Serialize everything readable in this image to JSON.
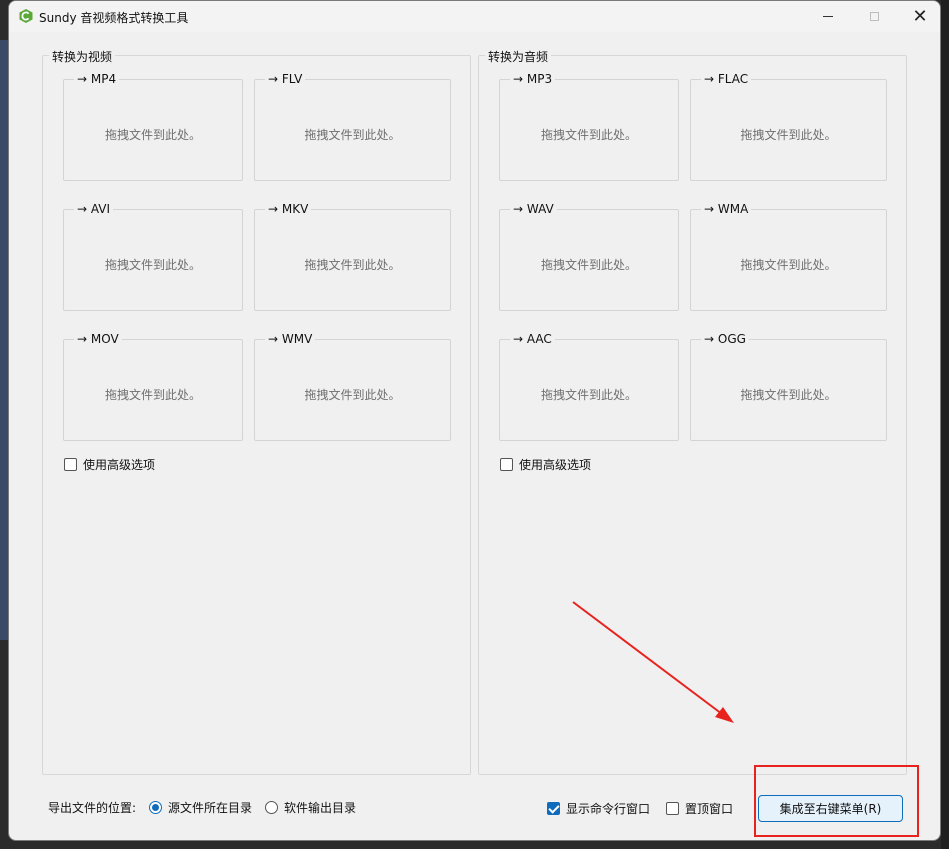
{
  "window": {
    "title": "Sundy 音视频格式转换工具",
    "close_glyph": "✕"
  },
  "video_group": {
    "title": "转换为视频",
    "targets": [
      {
        "label": "→ MP4",
        "hint": "拖拽文件到此处。"
      },
      {
        "label": "→ FLV",
        "hint": "拖拽文件到此处。"
      },
      {
        "label": "→ AVI",
        "hint": "拖拽文件到此处。"
      },
      {
        "label": "→ MKV",
        "hint": "拖拽文件到此处。"
      },
      {
        "label": "→ MOV",
        "hint": "拖拽文件到此处。"
      },
      {
        "label": "→ WMV",
        "hint": "拖拽文件到此处。"
      }
    ],
    "advanced_label": "使用高级选项",
    "advanced_checked": false
  },
  "audio_group": {
    "title": "转换为音频",
    "targets": [
      {
        "label": "→ MP3",
        "hint": "拖拽文件到此处。"
      },
      {
        "label": "→ FLAC",
        "hint": "拖拽文件到此处。"
      },
      {
        "label": "→ WAV",
        "hint": "拖拽文件到此处。"
      },
      {
        "label": "→ WMA",
        "hint": "拖拽文件到此处。"
      },
      {
        "label": "→ AAC",
        "hint": "拖拽文件到此处。"
      },
      {
        "label": "→ OGG",
        "hint": "拖拽文件到此处。"
      }
    ],
    "advanced_label": "使用高级选项",
    "advanced_checked": false
  },
  "footer": {
    "export_label": "导出文件的位置:",
    "radio_source_label": "源文件所在目录",
    "radio_output_label": "软件输出目录",
    "selected_export": "source",
    "show_console_label": "显示命令行窗口",
    "show_console_checked": true,
    "topmost_label": "置顶窗口",
    "topmost_checked": false,
    "integrate_button_label": "集成至右键菜单(R)"
  },
  "colors": {
    "accent": "#0f6cbd",
    "annotation_red": "#e8231f"
  }
}
